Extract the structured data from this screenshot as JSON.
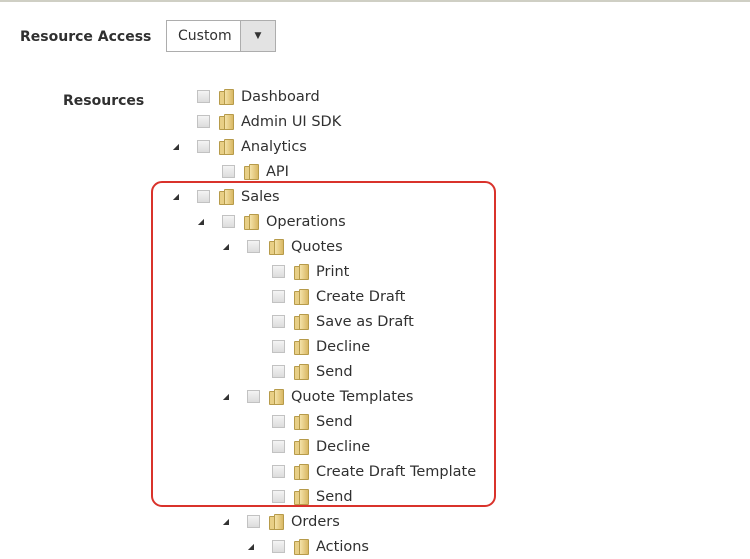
{
  "resource_access": {
    "label": "Resource Access",
    "value": "Custom"
  },
  "resources": {
    "label": "Resources",
    "tree": [
      {
        "label": "Dashboard",
        "level": 0,
        "expanded": false
      },
      {
        "label": "Admin UI SDK",
        "level": 0,
        "expanded": false
      },
      {
        "label": "Analytics",
        "level": 0,
        "expanded": true
      },
      {
        "label": "API",
        "level": 1,
        "expanded": false
      },
      {
        "label": "Sales",
        "level": 0,
        "expanded": true
      },
      {
        "label": "Operations",
        "level": 1,
        "expanded": true
      },
      {
        "label": "Quotes",
        "level": 2,
        "expanded": true
      },
      {
        "label": "Print",
        "level": 3,
        "expanded": false
      },
      {
        "label": "Create Draft",
        "level": 3,
        "expanded": false
      },
      {
        "label": "Save as Draft",
        "level": 3,
        "expanded": false
      },
      {
        "label": "Decline",
        "level": 3,
        "expanded": false
      },
      {
        "label": "Send",
        "level": 3,
        "expanded": false
      },
      {
        "label": "Quote Templates",
        "level": 2,
        "expanded": true
      },
      {
        "label": "Send",
        "level": 3,
        "expanded": false
      },
      {
        "label": "Decline",
        "level": 3,
        "expanded": false
      },
      {
        "label": "Create Draft Template",
        "level": 3,
        "expanded": false
      },
      {
        "label": "Send",
        "level": 3,
        "expanded": false
      },
      {
        "label": "Orders",
        "level": 2,
        "expanded": true
      },
      {
        "label": "Actions",
        "level": 3,
        "expanded": true
      }
    ]
  },
  "highlight_color": "#d9322b"
}
